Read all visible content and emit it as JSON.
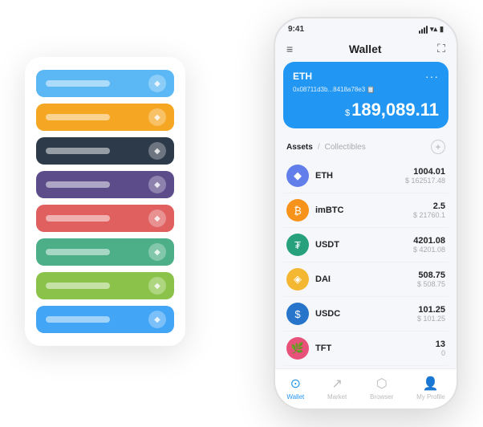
{
  "scene": {
    "bg_card": {
      "rows": [
        {
          "color": "#5bb8f5",
          "icon": "◆"
        },
        {
          "color": "#f5a623",
          "icon": "◆"
        },
        {
          "color": "#2d3a4a",
          "icon": "◆"
        },
        {
          "color": "#5c4d8a",
          "icon": "◆"
        },
        {
          "color": "#e06060",
          "icon": "◆"
        },
        {
          "color": "#4caf88",
          "icon": "◆"
        },
        {
          "color": "#8bc34a",
          "icon": "◆"
        },
        {
          "color": "#42a5f5",
          "icon": "◆"
        }
      ]
    },
    "phone": {
      "status_bar": {
        "time": "9:41",
        "signal": "●●●",
        "wifi": "wifi",
        "battery": "battery"
      },
      "header": {
        "menu_icon": "≡",
        "title": "Wallet",
        "expand_icon": "⛶"
      },
      "eth_card": {
        "title": "ETH",
        "dots": "···",
        "address": "0x08711d3b...8418a78e3 📋",
        "currency_symbol": "$",
        "balance": "189,089.11"
      },
      "assets_section": {
        "tab_active": "Assets",
        "divider": "/",
        "tab_inactive": "Collectibles",
        "add_icon": "+"
      },
      "asset_list": [
        {
          "name": "ETH",
          "icon_bg": "#627eea",
          "icon_char": "◆",
          "icon_color": "#fff",
          "amount": "1004.01",
          "usd": "$ 162517.48"
        },
        {
          "name": "imBTC",
          "icon_bg": "#f7931a",
          "icon_char": "₿",
          "icon_color": "#fff",
          "amount": "2.5",
          "usd": "$ 21760.1"
        },
        {
          "name": "USDT",
          "icon_bg": "#26a17b",
          "icon_char": "₮",
          "icon_color": "#fff",
          "amount": "4201.08",
          "usd": "$ 4201.08"
        },
        {
          "name": "DAI",
          "icon_bg": "#f4b731",
          "icon_char": "◈",
          "icon_color": "#fff",
          "amount": "508.75",
          "usd": "$ 508.75"
        },
        {
          "name": "USDC",
          "icon_bg": "#2775ca",
          "icon_char": "$",
          "icon_color": "#fff",
          "amount": "101.25",
          "usd": "$ 101.25"
        },
        {
          "name": "TFT",
          "icon_bg": "#e8527a",
          "icon_char": "🌿",
          "icon_color": "#fff",
          "amount": "13",
          "usd": "0"
        }
      ],
      "bottom_nav": [
        {
          "label": "Wallet",
          "icon": "⊙",
          "active": true
        },
        {
          "label": "Market",
          "icon": "📊",
          "active": false
        },
        {
          "label": "Browser",
          "icon": "👤",
          "active": false
        },
        {
          "label": "My Profile",
          "icon": "👤",
          "active": false
        }
      ]
    }
  }
}
